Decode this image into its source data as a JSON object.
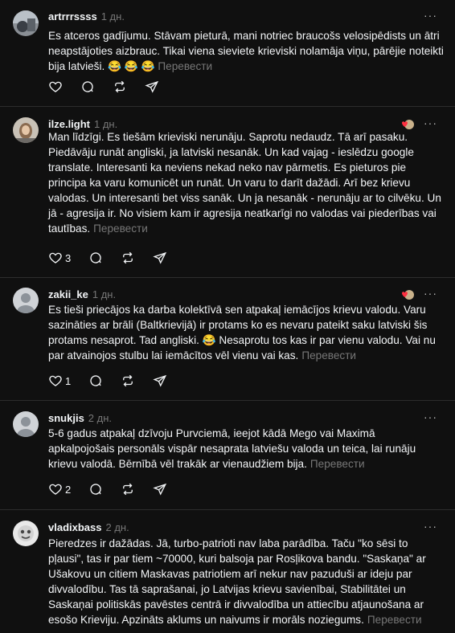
{
  "ui": {
    "translate_label": "Перевести",
    "more_label": "···"
  },
  "posts": [
    {
      "username": "artrrrssss",
      "time": "1 дн.",
      "text": "Es atceros gadījumu. Stāvam pieturā, mani notriec braucošs velosipēdists un ātri neapstājoties aizbrauc. Tikai viena sieviete krieviski nolamāja viņu, pārējie noteikti bija latvieši. 😂 😂 😂",
      "likes": "",
      "replies": "",
      "has_reaction": false
    },
    {
      "username": "ilze.light",
      "time": "1 дн.",
      "text": "Man līdzīgi. Es tiešām krieviski nerunāju. Saprotu nedaudz. Tā arī pasaku. Piedāvāju runāt angliski, ja latviski nesanāk. Un kad vajag - ieslēdzu google translate. Interesanti ka neviens nekad neko nav pārmetis. Es pieturos pie principa ka varu komunicēt un runāt. Un varu to darīt dažādi. Arī bez krievu valodas. Un interesanti bet viss sanāk. Un ja nesanāk - nerunāju ar to cilvēku. Un jā - agresija ir. No visiem kam ir agresija neatkarīgi no valodas vai piederības vai tautības.",
      "likes": "3",
      "replies": "",
      "has_reaction": true
    },
    {
      "username": "zakii_ke",
      "time": "1 дн.",
      "text": "Es tieši priecājos ka darba kolektīvā sen atpakaļ iemācījos krievu valodu. Varu sazināties ar brāli (Baltkrievijā) ir protams ko es nevaru pateikt saku latviski šis protams nesaprot. Tad angliski. 😂 Nesaprotu tos kas ir par vienu valodu. Vai nu par atvainojos stulbu lai iemācītos vēl vienu vai kas.",
      "likes": "1",
      "replies": "",
      "has_reaction": true
    },
    {
      "username": "snukjis",
      "time": "2 дн.",
      "text": "5-6 gadus atpakaļ dzīvoju Purvciemā, ieejot kādā Mego vai Maximā apkalpojošais personāls vispār nesaprata latviešu valoda un teica, lai runāju krievu valodā. Bērnībā vēl trakāk ar vienaudžiem bija.",
      "likes": "2",
      "replies": "",
      "has_reaction": false
    },
    {
      "username": "vladixbass",
      "time": "2 дн.",
      "text": "Pieredzes ir dažādas. Jā, turbo-patrioti nav laba parādība. Taču \"ko sēsi to pļausi\", tas ir par tiem ~70000, kuri balsoja par Rosļikova bandu. \"Saskaņa\" ar Ušakovu un citiem Maskavas patriotiem arī nekur nav pazuduši ar ideju par divvalodību. Tas tā saprašanai, jo Latvijas krievu savienībai, Stabilitātei un Saskaņai politiskās pavēstes centrā ir divvalodība un attiecību atjaunošana ar esošo Krieviju. Apzināts aklums un naivums ir morāls noziegums.",
      "likes": "",
      "replies": "",
      "has_reaction": false
    }
  ]
}
